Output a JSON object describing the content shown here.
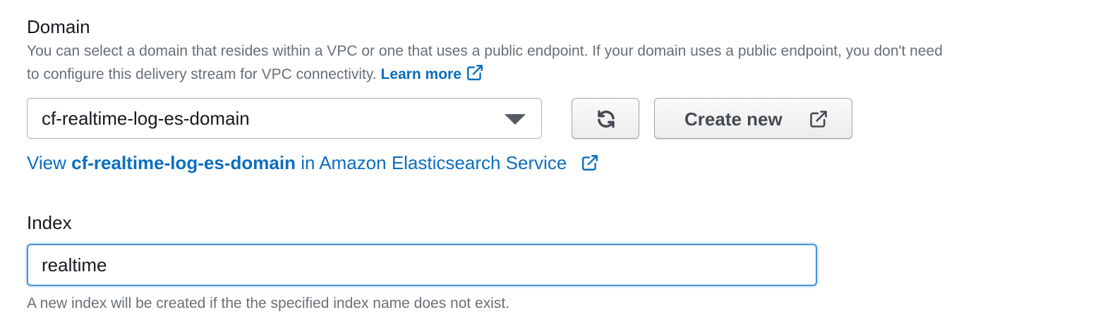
{
  "domain": {
    "label": "Domain",
    "description_line1": "You can select a domain that resides within a VPC or one that uses a public endpoint. If your domain uses a public endpoint, you don't need",
    "description_line2": "to configure this delivery stream for VPC connectivity.",
    "learn_more": "Learn more",
    "selected_value": "cf-realtime-log-es-domain",
    "create_new_label": "Create new",
    "view_prefix": "View",
    "view_domain_name": "cf-realtime-log-es-domain",
    "view_suffix": "in Amazon Elasticsearch Service"
  },
  "index": {
    "label": "Index",
    "value": "realtime",
    "hint": "A new index will be created if the the specified index name does not exist."
  },
  "icons": {
    "external": "external-link-icon",
    "refresh": "refresh-icon",
    "dropdown": "caret-down-icon"
  },
  "colors": {
    "link": "#0b6ebf",
    "muted_text": "#687078",
    "focus_border": "#4a90d9"
  }
}
